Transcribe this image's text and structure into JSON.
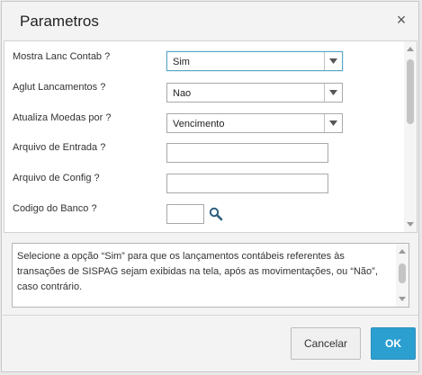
{
  "dialog": {
    "title": "Parametros",
    "close_symbol": "×"
  },
  "params": [
    {
      "label": "Mostra Lanc Contab ?",
      "type": "select",
      "value": "Sim",
      "focused": true
    },
    {
      "label": "Aglut Lancamentos ?",
      "type": "select",
      "value": "Nao"
    },
    {
      "label": "Atualiza Moedas por ?",
      "type": "select",
      "value": "Vencimento"
    },
    {
      "label": "Arquivo de Entrada ?",
      "type": "text",
      "value": ""
    },
    {
      "label": "Arquivo de Config ?",
      "type": "text",
      "value": ""
    },
    {
      "label": "Codigo do Banco ?",
      "type": "lookup",
      "value": ""
    }
  ],
  "help": {
    "text": "Selecione a opção “Sim” para que os lançamentos contábeis referentes às transações de SISPAG sejam exibidas na tela, após as movimentações, ou “Não”, caso contrário."
  },
  "buttons": {
    "cancel_label": "Cancelar",
    "ok_label": "OK"
  },
  "icons": {
    "close": "close-icon",
    "dropdown": "chevron-down-icon",
    "lookup": "search-icon"
  },
  "colors": {
    "primary": "#2c9fd1",
    "focus": "#5aa7c9"
  }
}
